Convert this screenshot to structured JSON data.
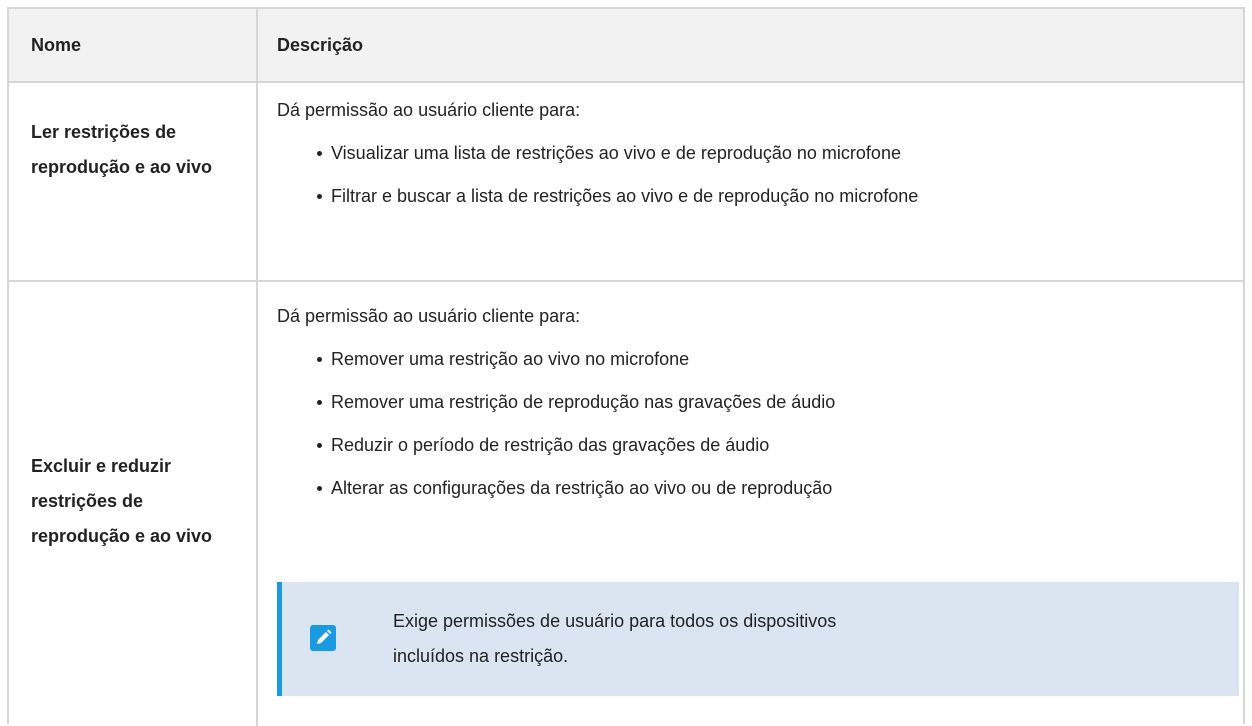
{
  "header": {
    "name_label": "Nome",
    "description_label": "Descrição"
  },
  "rows": [
    {
      "name": "Ler restrições de reprodução e ao vivo",
      "intro": "Dá permissão ao usuário cliente para:",
      "bullets": [
        "Visualizar uma lista de restrições ao vivo e de reprodução no microfone",
        "Filtrar e buscar a lista de restrições ao vivo e de reprodução no microfone"
      ]
    },
    {
      "name": "Excluir e reduzir restrições de reprodução e ao vivo",
      "intro": "Dá permissão ao usuário cliente para:",
      "bullets": [
        "Remover uma restrição ao vivo no microfone",
        "Remover uma restrição de reprodução nas gravações de áudio",
        "Reduzir o período de restrição das gravações de áudio",
        "Alterar as configurações da restrição ao vivo ou de reprodução"
      ],
      "note": {
        "icon": "pencil-icon",
        "line1": "Exige permissões de usuário para todos os dispositivos",
        "line2": "incluídos na restrição."
      }
    }
  ],
  "colors": {
    "header_bg": "#f2f2f2",
    "border": "#d6d6d6",
    "note_bg": "#dbe4f1",
    "accent": "#1a9be0"
  }
}
